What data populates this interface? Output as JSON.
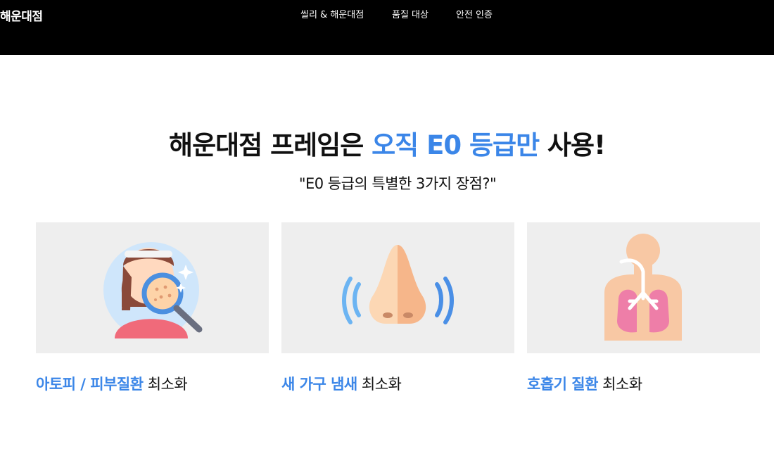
{
  "header": {
    "logo": "해운대점",
    "nav": [
      "씰리 & 해운대점",
      "품질 대상",
      "안전 인증"
    ]
  },
  "main": {
    "headline_prefix": "해운대점 프레임은 ",
    "headline_accent": "오직 E0 등급만",
    "headline_suffix": " 사용!",
    "subheadline": "\"E0 등급의 특별한 3가지 장점?\""
  },
  "features": [
    {
      "icon": "skin-inspection-icon",
      "accent": "아토피 / 피부질환",
      "rest": " 최소화"
    },
    {
      "icon": "nose-smell-icon",
      "accent": "새 가구 냄새",
      "rest": " 최소화"
    },
    {
      "icon": "lungs-icon",
      "accent": "호흡기 질환",
      "rest": " 최소화"
    }
  ],
  "colors": {
    "header_bg": "#000000",
    "accent": "#3b86e8",
    "card_bg": "#eeeeee"
  }
}
